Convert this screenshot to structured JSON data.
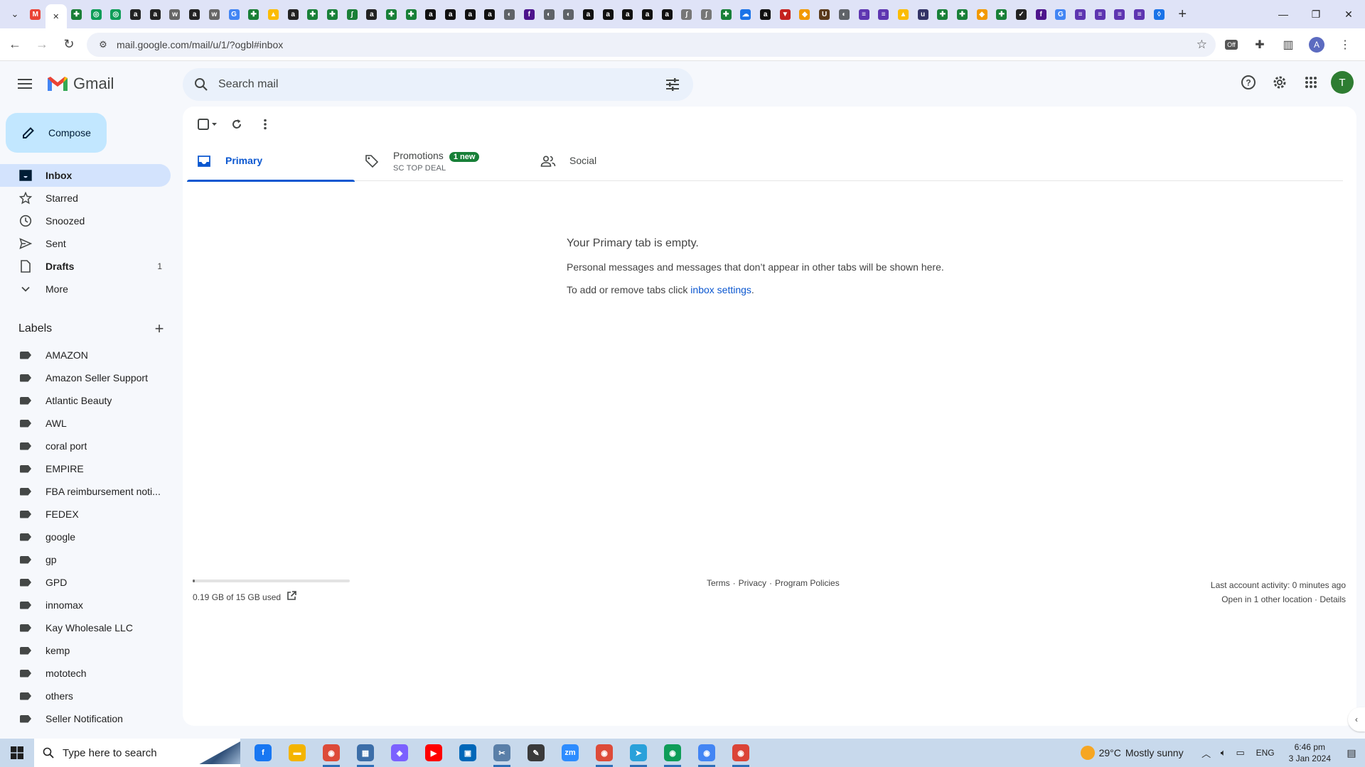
{
  "browser": {
    "tab_favicons": [
      {
        "icon": "gmail-favicon-icon",
        "color": "#ea4335",
        "glyph": "M"
      },
      {
        "icon": "globe-favicon-icon",
        "color": "#5f6368",
        "glyph": "◐"
      },
      {
        "icon": "puzzle-favicon-icon",
        "color": "#1a7f37",
        "glyph": "✚"
      },
      {
        "icon": "circle-favicon-icon",
        "color": "#0f9d58",
        "glyph": "◎"
      },
      {
        "icon": "circle-favicon-icon",
        "color": "#0f9d58",
        "glyph": "◎"
      },
      {
        "icon": "amazon-favicon-icon",
        "color": "#222222",
        "glyph": "a"
      },
      {
        "icon": "amazon-favicon-icon",
        "color": "#222222",
        "glyph": "a"
      },
      {
        "icon": "wix-favicon-icon",
        "color": "#666666",
        "glyph": "w"
      },
      {
        "icon": "amazon-favicon-icon",
        "color": "#222222",
        "glyph": "a"
      },
      {
        "icon": "wix-favicon-icon",
        "color": "#666666",
        "glyph": "w"
      },
      {
        "icon": "google-favicon-icon",
        "color": "#4285f4",
        "glyph": "G"
      },
      {
        "icon": "puzzle-favicon-icon",
        "color": "#1a7f37",
        "glyph": "✚"
      },
      {
        "icon": "drive-favicon-icon",
        "color": "#fbbc04",
        "glyph": "▲"
      },
      {
        "icon": "amazon-favicon-icon",
        "color": "#222222",
        "glyph": "a"
      },
      {
        "icon": "sheets-favicon-icon",
        "color": "#188038",
        "glyph": "✚"
      },
      {
        "icon": "sheets-favicon-icon",
        "color": "#188038",
        "glyph": "✚"
      },
      {
        "icon": "script-favicon-icon",
        "color": "#1a7f37",
        "glyph": "∫"
      },
      {
        "icon": "amazon-favicon-icon",
        "color": "#222222",
        "glyph": "a"
      },
      {
        "icon": "sheets-favicon-icon",
        "color": "#188038",
        "glyph": "✚"
      },
      {
        "icon": "sheets-favicon-icon",
        "color": "#188038",
        "glyph": "✚"
      },
      {
        "icon": "amazon-favicon-icon",
        "color": "#111111",
        "glyph": "a"
      },
      {
        "icon": "amazon-favicon-icon",
        "color": "#111111",
        "glyph": "a"
      },
      {
        "icon": "amazon-favicon-icon",
        "color": "#111111",
        "glyph": "a"
      },
      {
        "icon": "amazon-favicon-icon",
        "color": "#111111",
        "glyph": "a"
      },
      {
        "icon": "globe-favicon-icon",
        "color": "#5f6368",
        "glyph": "◐"
      },
      {
        "icon": "fedex-favicon-icon",
        "color": "#4d148c",
        "glyph": "f"
      },
      {
        "icon": "globe-favicon-icon",
        "color": "#5f6368",
        "glyph": "◐"
      },
      {
        "icon": "globe-favicon-icon",
        "color": "#5f6368",
        "glyph": "◐"
      },
      {
        "icon": "amazon-favicon-icon",
        "color": "#111111",
        "glyph": "a"
      },
      {
        "icon": "amazon-favicon-icon",
        "color": "#111111",
        "glyph": "a"
      },
      {
        "icon": "amazon-favicon-icon",
        "color": "#111111",
        "glyph": "a"
      },
      {
        "icon": "amazon-favicon-icon",
        "color": "#111111",
        "glyph": "a"
      },
      {
        "icon": "amazon-favicon-icon",
        "color": "#111111",
        "glyph": "a"
      },
      {
        "icon": "script-favicon-icon",
        "color": "#777777",
        "glyph": "∫"
      },
      {
        "icon": "script-favicon-icon",
        "color": "#777777",
        "glyph": "∫"
      },
      {
        "icon": "sheets-favicon-icon",
        "color": "#188038",
        "glyph": "✚"
      },
      {
        "icon": "cloud-favicon-icon",
        "color": "#1a73e8",
        "glyph": "☁"
      },
      {
        "icon": "amazon-favicon-icon",
        "color": "#111111",
        "glyph": "a"
      },
      {
        "icon": "shield-favicon-icon",
        "color": "#c5221f",
        "glyph": "▼"
      },
      {
        "icon": "tag-favicon-icon",
        "color": "#f29900",
        "glyph": "◆"
      },
      {
        "icon": "ups-favicon-icon",
        "color": "#5a3a1a",
        "glyph": "U"
      },
      {
        "icon": "globe-favicon-icon",
        "color": "#5f6368",
        "glyph": "◐"
      },
      {
        "icon": "forms-favicon-icon",
        "color": "#5e35b1",
        "glyph": "≡"
      },
      {
        "icon": "forms-favicon-icon",
        "color": "#5e35b1",
        "glyph": "≡"
      },
      {
        "icon": "drive-favicon-icon",
        "color": "#fbbc04",
        "glyph": "▲"
      },
      {
        "icon": "usps-favicon-icon",
        "color": "#333366",
        "glyph": "u"
      },
      {
        "icon": "sheets-favicon-icon",
        "color": "#188038",
        "glyph": "✚"
      },
      {
        "icon": "sheets-favicon-icon",
        "color": "#188038",
        "glyph": "✚"
      },
      {
        "icon": "tag-favicon-icon",
        "color": "#f29900",
        "glyph": "◆"
      },
      {
        "icon": "sheets-favicon-icon",
        "color": "#188038",
        "glyph": "✚"
      },
      {
        "icon": "check-favicon-icon",
        "color": "#222222",
        "glyph": "✓"
      },
      {
        "icon": "fedex-favicon-icon",
        "color": "#4d148c",
        "glyph": "f"
      },
      {
        "icon": "google-favicon-icon",
        "color": "#4285f4",
        "glyph": "G"
      },
      {
        "icon": "forms-favicon-icon",
        "color": "#5e35b1",
        "glyph": "≡"
      },
      {
        "icon": "forms-favicon-icon",
        "color": "#5e35b1",
        "glyph": "≡"
      },
      {
        "icon": "forms-favicon-icon",
        "color": "#5e35b1",
        "glyph": "≡"
      },
      {
        "icon": "forms-favicon-icon",
        "color": "#5e35b1",
        "glyph": "≡"
      },
      {
        "icon": "droplet-favicon-icon",
        "color": "#1a73e8",
        "glyph": "◊"
      }
    ],
    "active_tab_index": 1,
    "url": "mail.google.com/mail/u/1/?ogbl#inbox",
    "profile_initial": "A"
  },
  "gmail": {
    "logo_text": "Gmail",
    "search_placeholder": "Search mail",
    "account_initial": "T",
    "compose_label": "Compose",
    "mailboxes": [
      {
        "label": "Inbox",
        "icon": "inbox-icon",
        "active": true,
        "bold": true,
        "count": ""
      },
      {
        "label": "Starred",
        "icon": "star-icon",
        "active": false,
        "bold": false,
        "count": ""
      },
      {
        "label": "Snoozed",
        "icon": "clock-icon",
        "active": false,
        "bold": false,
        "count": ""
      },
      {
        "label": "Sent",
        "icon": "send-icon",
        "active": false,
        "bold": false,
        "count": ""
      },
      {
        "label": "Drafts",
        "icon": "draft-icon",
        "active": false,
        "bold": true,
        "count": "1"
      },
      {
        "label": "More",
        "icon": "chevron-down-icon",
        "active": false,
        "bold": false,
        "count": ""
      }
    ],
    "labels_title": "Labels",
    "labels": [
      "AMAZON",
      "Amazon Seller Support",
      "Atlantic Beauty",
      "AWL",
      "coral port",
      "EMPIRE",
      "FBA reimbursement noti...",
      "FEDEX",
      "google",
      "gp",
      "GPD",
      "innomax",
      "Kay Wholesale LLC",
      "kemp",
      "mototech",
      "others",
      "Seller Notification"
    ],
    "tabs": [
      {
        "label": "Primary",
        "icon": "inbox-tab-icon",
        "active": true,
        "badge": "",
        "sub": ""
      },
      {
        "label": "Promotions",
        "icon": "tag-icon",
        "active": false,
        "badge": "1 new",
        "sub": "SC TOP DEAL"
      },
      {
        "label": "Social",
        "icon": "people-icon",
        "active": false,
        "badge": "",
        "sub": ""
      }
    ],
    "empty": {
      "heading": "Your Primary tab is empty.",
      "line1": "Personal messages and messages that don’t appear in other tabs will be shown here.",
      "line2_prefix": "To add or remove tabs click ",
      "line2_link": "inbox settings",
      "line2_suffix": "."
    },
    "footer": {
      "storage_used_fraction": 0.0127,
      "storage_text": "0.19 GB of 15 GB used",
      "links": [
        "Terms",
        "·",
        "Privacy",
        "·",
        "Program Policies"
      ],
      "activity_line1": "Last account activity: 0 minutes ago",
      "activity_line2_prefix": "Open in 1 other location · ",
      "activity_line2_link": "Details"
    }
  },
  "taskbar": {
    "search_placeholder": "Type here to search",
    "apps": [
      {
        "icon": "facebook-icon",
        "color": "#1877f2",
        "glyph": "f",
        "running": false
      },
      {
        "icon": "file-explorer-icon",
        "color": "#f4b400",
        "glyph": "▬",
        "running": false
      },
      {
        "icon": "chrome-icon",
        "color": "#dd4b39",
        "glyph": "◉",
        "running": true
      },
      {
        "icon": "calculator-icon",
        "color": "#3c6ea8",
        "glyph": "▦",
        "running": true
      },
      {
        "icon": "copilot-icon",
        "color": "#7b61ff",
        "glyph": "◈",
        "running": false
      },
      {
        "icon": "youtube-icon",
        "color": "#ff0000",
        "glyph": "▶",
        "running": false
      },
      {
        "icon": "store-icon",
        "color": "#0067b8",
        "glyph": "▣",
        "running": false
      },
      {
        "icon": "snipping-tool-icon",
        "color": "#5a7fa8",
        "glyph": "✂",
        "running": true
      },
      {
        "icon": "sticky-notes-icon",
        "color": "#3a3a3a",
        "glyph": "✎",
        "running": false
      },
      {
        "icon": "zoom-icon",
        "color": "#2d8cff",
        "glyph": "zm",
        "running": false
      },
      {
        "icon": "chrome-icon",
        "color": "#dd4b39",
        "glyph": "◉",
        "running": true
      },
      {
        "icon": "telegram-icon",
        "color": "#2aa1da",
        "glyph": "➤",
        "running": true
      },
      {
        "icon": "chrome-icon",
        "color": "#0f9d58",
        "glyph": "◉",
        "running": true
      },
      {
        "icon": "chrome-icon",
        "color": "#4285f4",
        "glyph": "◉",
        "running": true
      },
      {
        "icon": "chrome-icon",
        "color": "#db4437",
        "glyph": "◉",
        "running": true
      }
    ],
    "weather_temp": "29°C",
    "weather_desc": "Mostly sunny",
    "language": "ENG",
    "time": "6:46 pm",
    "date": "3 Jan 2024"
  }
}
